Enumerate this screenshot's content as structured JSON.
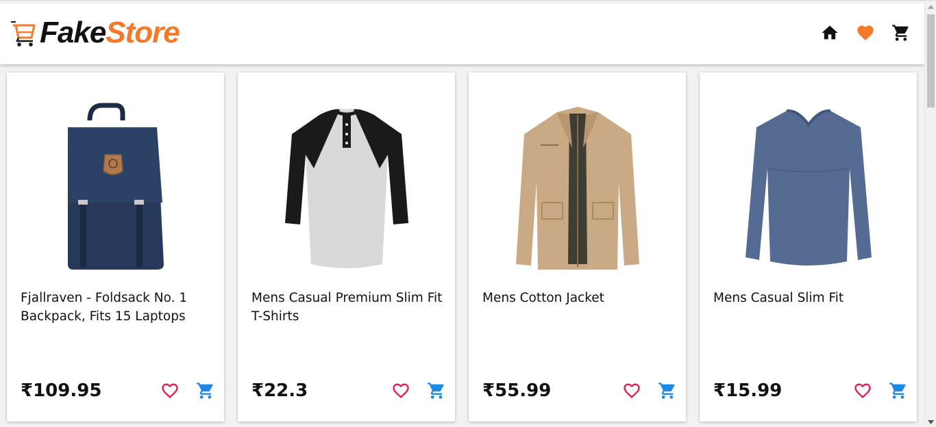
{
  "brand": {
    "part1": "Fake",
    "part2": "Store",
    "accent": "#f47a2a"
  },
  "nav": [
    {
      "name": "home-icon"
    },
    {
      "name": "heart-icon",
      "color": "#f47a2a"
    },
    {
      "name": "cart-icon"
    }
  ],
  "products": [
    {
      "title": "Fjallraven - Foldsack No. 1 Backpack, Fits 15 Laptops",
      "price": "₹109.95",
      "image": "backpack"
    },
    {
      "title": "Mens Casual Premium Slim Fit T-Shirts",
      "price": "₹22.3",
      "image": "raglan-tshirt"
    },
    {
      "title": "Mens Cotton Jacket",
      "price": "₹55.99",
      "image": "jacket"
    },
    {
      "title": "Mens Casual Slim Fit",
      "price": "₹15.99",
      "image": "long-sleeve-tee"
    }
  ],
  "colors": {
    "wishlist": "#e8194e",
    "add_to_cart": "#1e88e5"
  }
}
